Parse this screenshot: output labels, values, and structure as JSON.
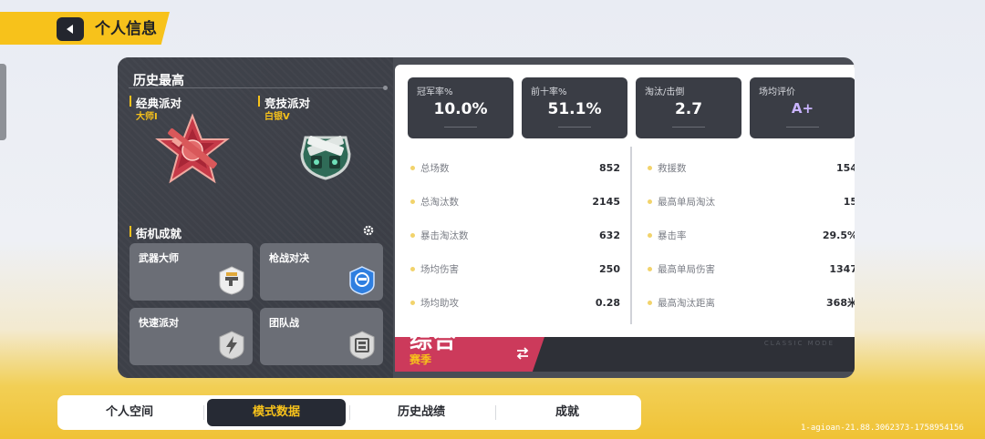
{
  "header": {
    "title": "个人信息"
  },
  "history": {
    "title": "历史最高",
    "classic": {
      "label": "经典派对",
      "rank": "大师I"
    },
    "competitive": {
      "label": "竞技派对",
      "rank": "白银V"
    }
  },
  "arcade": {
    "title": "街机成就",
    "cards": [
      {
        "name": "武器大师",
        "icon": "gun-badge-icon"
      },
      {
        "name": "枪战对决",
        "icon": "blue-shield-badge-icon"
      },
      {
        "name": "快速派对",
        "icon": "lightning-badge-icon"
      },
      {
        "name": "团队战",
        "icon": "team-badge-icon"
      }
    ]
  },
  "stats_cards": [
    {
      "label": "冠军率%",
      "value": "10.0%"
    },
    {
      "label": "前十率%",
      "value": "51.1%"
    },
    {
      "label": "淘汰/击倒",
      "value": "2.7"
    },
    {
      "label": "场均评价",
      "value": "A+"
    }
  ],
  "stats_left": [
    {
      "label": "总场数",
      "value": "852"
    },
    {
      "label": "总淘汰数",
      "value": "2145"
    },
    {
      "label": "暴击淘汰数",
      "value": "632"
    },
    {
      "label": "场均伤害",
      "value": "250"
    },
    {
      "label": "场均助攻",
      "value": "0.28"
    }
  ],
  "stats_right": [
    {
      "label": "救援数",
      "value": "154"
    },
    {
      "label": "最高单局淘汰",
      "value": "15"
    },
    {
      "label": "暴击率",
      "value": "29.5%"
    },
    {
      "label": "最高单局伤害",
      "value": "1347"
    },
    {
      "label": "最高淘汰距离",
      "value": "368米"
    }
  ],
  "season": {
    "main": "综合",
    "sub": "赛季",
    "watermark": "CLASSIC MODE"
  },
  "tabs": [
    {
      "label": "个人空间"
    },
    {
      "label": "模式数据",
      "active": true
    },
    {
      "label": "历史战绩"
    },
    {
      "label": "成就"
    }
  ],
  "footer": {
    "id": "1-agioan-21.88.3062373-1758954156"
  },
  "colors": {
    "accent": "#f7c21b",
    "season_red": "#cc3a5b",
    "panel_dark": "#3a3d45"
  }
}
